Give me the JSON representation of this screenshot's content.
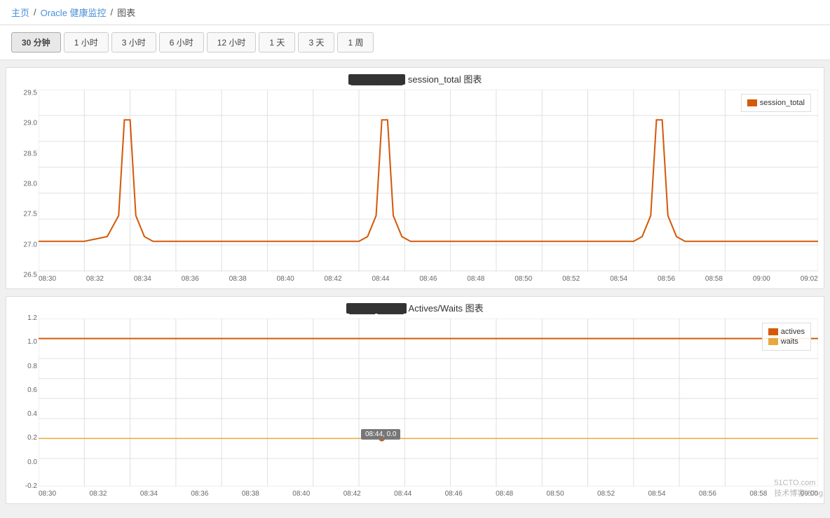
{
  "header": {
    "home_label": "主页",
    "sep1": "/",
    "oracle_label": "Oracle 健康监控",
    "sep2": "/",
    "page_label": "图表"
  },
  "toolbar": {
    "buttons": [
      {
        "label": "30 分钟",
        "active": true
      },
      {
        "label": "1 小时",
        "active": false
      },
      {
        "label": "3 小时",
        "active": false
      },
      {
        "label": "6 小时",
        "active": false
      },
      {
        "label": "12 小时",
        "active": false
      },
      {
        "label": "1 天",
        "active": false
      },
      {
        "label": "3 天",
        "active": false
      },
      {
        "label": "1 周",
        "active": false
      }
    ]
  },
  "chart1": {
    "title": "████████ session_total 图表",
    "legend": [
      {
        "label": "session_total",
        "color": "#d45a0a"
      }
    ],
    "y_labels": [
      "29.5",
      "29.0",
      "28.5",
      "28.0",
      "27.5",
      "27.0",
      "26.5"
    ],
    "x_labels": [
      "08:30",
      "08:32",
      "08:34",
      "08:36",
      "08:38",
      "08:40",
      "08:42",
      "08:44",
      "08:46",
      "08:48",
      "08:50",
      "08:52",
      "08:54",
      "08:56",
      "08:58",
      "09:00",
      "09:02"
    ]
  },
  "chart2": {
    "title": "████ ████ Actives/Waits 图表",
    "legend": [
      {
        "label": "actives",
        "color": "#d45a0a"
      },
      {
        "label": "waits",
        "color": "#e8a840"
      }
    ],
    "y_labels": [
      "1.2",
      "1.0",
      "0.8",
      "0.6",
      "0.4",
      "0.2",
      "0.0",
      "-0.2"
    ],
    "x_labels": [
      "08:30",
      "08:32",
      "08:34",
      "08:36",
      "08:38",
      "08:40",
      "08:42",
      "08:44",
      "08:46",
      "08:48",
      "08:50",
      "08:52",
      "08:54",
      "08:56",
      "08:58",
      "09:00"
    ],
    "tooltip": "08:44, 0.0"
  },
  "watermark": "51CTO.com\n技术博客·Blog"
}
